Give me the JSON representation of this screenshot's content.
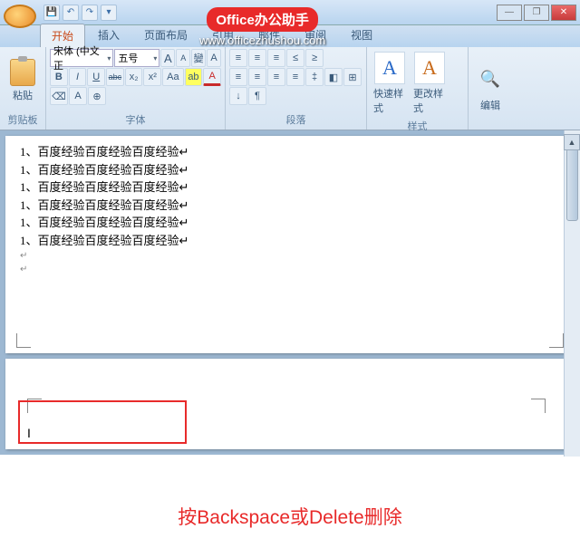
{
  "watermark": {
    "badge_prefix": "Office",
    "badge_suffix": "办公助手",
    "url": "www.officezhushou.com"
  },
  "qat": {
    "save": "💾",
    "undo": "↶",
    "redo": "↷",
    "more": "▾"
  },
  "win": {
    "min": "—",
    "max": "❐",
    "close": "✕"
  },
  "tabs": {
    "home": "开始",
    "insert": "插入",
    "layout": "页面布局",
    "ref": "引用",
    "mail": "邮件",
    "review": "审阅",
    "view": "视图"
  },
  "clipboard": {
    "paste": "粘贴",
    "label": "剪贴板"
  },
  "font": {
    "family": "宋体 (中文正",
    "size": "五号",
    "grow": "A",
    "shrink": "A",
    "clear": "⌫",
    "phonetic": "變",
    "charborder": "A",
    "bold": "B",
    "italic": "I",
    "underline": "U",
    "strike": "abc",
    "sub": "x₂",
    "sup": "x²",
    "case": "Aa",
    "highlight": "ab",
    "color": "A",
    "label": "字体"
  },
  "para": {
    "bullets": "≡",
    "numbers": "≡",
    "multilist": "≡",
    "dedent": "≤",
    "indent": "≥",
    "sort": "↓",
    "marks": "¶",
    "alignL": "≡",
    "alignC": "≡",
    "alignR": "≡",
    "alignJ": "≡",
    "spacing": "‡",
    "shading": "◧",
    "border": "⊞",
    "label": "段落"
  },
  "styles": {
    "quick": "快速样式",
    "change": "更改样式",
    "label": "样式"
  },
  "editing": {
    "find": "编辑",
    "label": ""
  },
  "doc": {
    "lines": [
      "1、百度经验百度经验百度经验↵",
      "1、百度经验百度经验百度经验↵",
      "1、百度经验百度经验百度经验↵",
      "1、百度经验百度经验百度经验↵",
      "1、百度经验百度经验百度经验↵",
      "1、百度经验百度经验百度经验↵"
    ],
    "para": "↵"
  },
  "caption": "按Backspace或Delete删除"
}
